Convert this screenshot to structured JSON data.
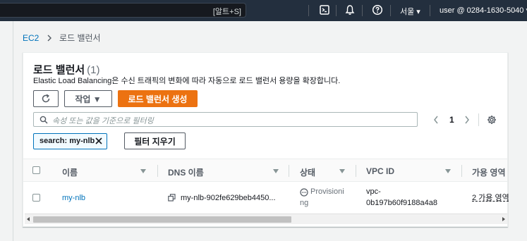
{
  "topnav": {
    "search_shortcut": "[알트+S]",
    "region": "서울 ▾",
    "user": "user @ 0284-1630-5040 ▾"
  },
  "breadcrumb": {
    "root": "EC2",
    "current": "로드 밸런서"
  },
  "panel": {
    "title": "로드 밸런서",
    "count": "(1)",
    "description": "Elastic Load Balancing은 수신 트래픽의 변화에 따라 자동으로 로드 밸런서 용량을 확장합니다."
  },
  "toolbar": {
    "actions_label": "작업 ▼",
    "create_label": "로드 밸런서 생성"
  },
  "filter": {
    "placeholder": "속성 또는 값을 기준으로 필터링",
    "token_label": "search: my-nlb",
    "clear_label": "필터 지우기"
  },
  "pagination": {
    "page": "1"
  },
  "table": {
    "columns": [
      "이름",
      "DNS 이름",
      "상태",
      "VPC ID",
      "가용 영역"
    ],
    "rows": [
      {
        "name": "my-nlb",
        "dns": "my-nlb-902fe629beb4450...",
        "status_line1": "Provisioni",
        "status_line2": "ng",
        "vpc_line1": "vpc-",
        "vpc_line2": "0b197b60f9188a4a8",
        "az": "2 가용 영역"
      }
    ]
  },
  "colors": {
    "nav_bg": "#232f3e",
    "link": "#0073bb",
    "primary": "#ec7211"
  }
}
